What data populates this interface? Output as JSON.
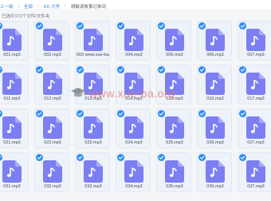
{
  "breadcrumb": {
    "items": [
      "上一级",
      "全部",
      "KD 大学",
      "胡敏读故事记单词"
    ],
    "current": "胡敏读故事记单词"
  },
  "selection_count": "已选中172个文件/文件夹",
  "watermark": {
    "text": "www.xue-ba.org"
  },
  "files": [
    "001.mp3",
    "002.mp3",
    "003 www.xue-ba.",
    "004.mp3",
    "005.mp3",
    "006.mp3",
    "007.mp3",
    "011.mp3",
    "012.mp3",
    "013.mp3",
    "014.mp3",
    "015.mp3",
    "016.mp3",
    "017.mp3",
    "021.mp3",
    "022.mp3",
    "023.mp3",
    "024.mp3",
    "025.mp3",
    "026.mp3",
    "027.mp3",
    "031.mp3",
    "032.mp3",
    "033.mp3",
    "034.mp3",
    "035.mp3",
    "036.mp3",
    "037.mp3"
  ],
  "colors": {
    "accent": "#2e8ef5",
    "file_icon": "#7b7ff2",
    "link": "#3a86d8"
  },
  "icons": {
    "check": "check-icon",
    "file": "music-file-icon"
  }
}
